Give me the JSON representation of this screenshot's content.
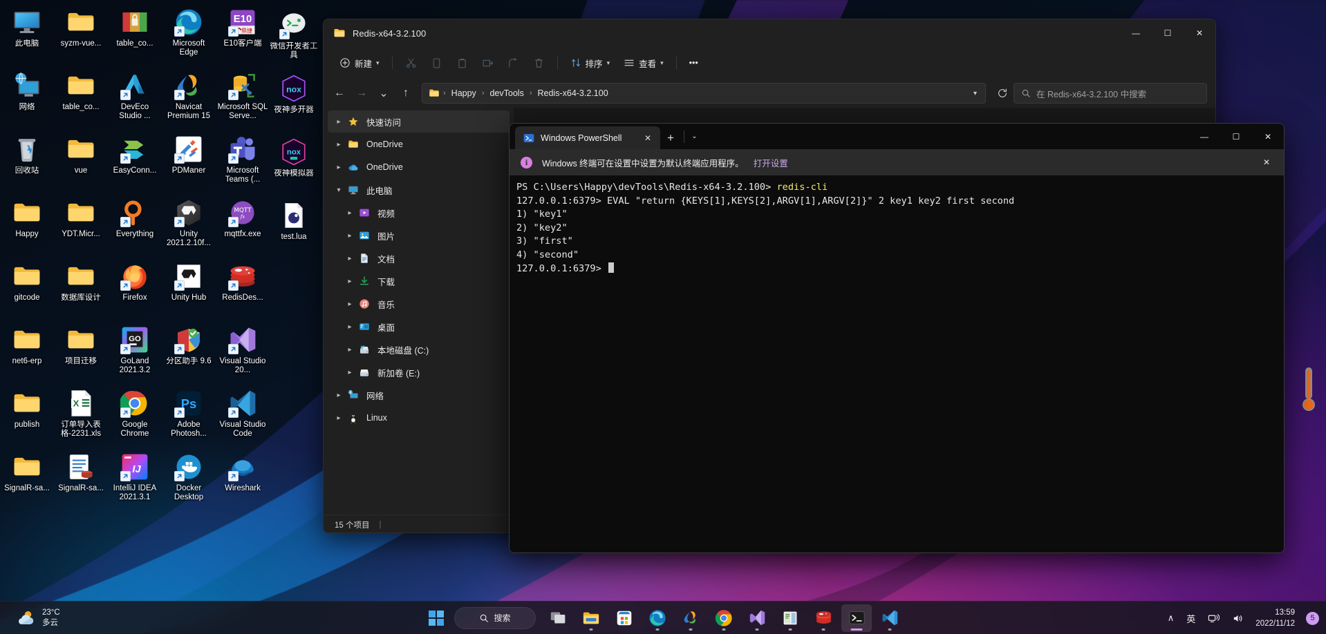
{
  "desktop": {
    "icons": [
      {
        "label": "此电脑",
        "icon": "this-pc-icon",
        "shortcut": false
      },
      {
        "label": "syzm-vue...",
        "icon": "folder-icon",
        "shortcut": false
      },
      {
        "label": "table_co...",
        "icon": "winrar-archive-icon",
        "shortcut": false
      },
      {
        "label": "Microsoft Edge",
        "icon": "microsoft-edge-icon",
        "shortcut": true
      },
      {
        "label": "E10客户端",
        "icon": "e10-client-icon",
        "shortcut": true
      },
      {
        "label": "网络",
        "icon": "network-icon",
        "shortcut": false
      },
      {
        "label": "table_co...",
        "icon": "folder-icon",
        "shortcut": false
      },
      {
        "label": "DevEco Studio ...",
        "icon": "deveco-studio-icon",
        "shortcut": true
      },
      {
        "label": "Navicat Premium 15",
        "icon": "navicat-icon",
        "shortcut": true
      },
      {
        "label": "Microsoft SQL Serve...",
        "icon": "sql-server-icon",
        "shortcut": true
      },
      {
        "label": "回收站",
        "icon": "recycle-bin-icon",
        "shortcut": false
      },
      {
        "label": "vue",
        "icon": "folder-icon",
        "shortcut": false
      },
      {
        "label": "EasyConn...",
        "icon": "easyconnect-icon",
        "shortcut": true
      },
      {
        "label": "PDManer",
        "icon": "pdmaner-icon",
        "shortcut": true
      },
      {
        "label": "Microsoft Teams (...",
        "icon": "microsoft-teams-icon",
        "shortcut": true
      },
      {
        "label": "Happy",
        "icon": "folder-icon",
        "shortcut": false
      },
      {
        "label": "YDT.Micr...",
        "icon": "folder-icon",
        "shortcut": false
      },
      {
        "label": "Everything",
        "icon": "everything-icon",
        "shortcut": true
      },
      {
        "label": "Unity 2021.2.10f...",
        "icon": "unity-icon",
        "shortcut": true
      },
      {
        "label": "mqttfx.exe",
        "icon": "mqttfx-icon",
        "shortcut": true
      },
      {
        "label": "gitcode",
        "icon": "folder-icon",
        "shortcut": false
      },
      {
        "label": "数据库设计",
        "icon": "folder-icon",
        "shortcut": false
      },
      {
        "label": "Firefox",
        "icon": "firefox-icon",
        "shortcut": true
      },
      {
        "label": "Unity Hub",
        "icon": "unity-hub-icon",
        "shortcut": true
      },
      {
        "label": "RedisDes...",
        "icon": "redis-desktop-icon",
        "shortcut": true
      },
      {
        "label": "net6-erp",
        "icon": "folder-icon",
        "shortcut": false
      },
      {
        "label": "项目迁移",
        "icon": "folder-icon",
        "shortcut": false
      },
      {
        "label": "GoLand 2021.3.2",
        "icon": "goland-icon",
        "shortcut": true
      },
      {
        "label": "分区助手 9.6",
        "icon": "partition-assistant-icon",
        "shortcut": true
      },
      {
        "label": "Visual Studio 20...",
        "icon": "visual-studio-icon",
        "shortcut": true
      },
      {
        "label": "publish",
        "icon": "folder-icon",
        "shortcut": false
      },
      {
        "label": "订单导入表格-2231.xls",
        "icon": "excel-file-icon",
        "shortcut": false
      },
      {
        "label": "Google Chrome",
        "icon": "google-chrome-icon",
        "shortcut": true
      },
      {
        "label": "Adobe Photosh...",
        "icon": "photoshop-icon",
        "shortcut": true
      },
      {
        "label": "Visual Studio Code",
        "icon": "vscode-icon",
        "shortcut": true
      },
      {
        "label": "SignalR-sa...",
        "icon": "folder-icon",
        "shortcut": false
      },
      {
        "label": "SignalR-sa...",
        "icon": "sql-script-icon",
        "shortcut": false
      },
      {
        "label": "IntelliJ IDEA 2021.3.1",
        "icon": "intellij-idea-icon",
        "shortcut": true
      },
      {
        "label": "Docker Desktop",
        "icon": "docker-icon",
        "shortcut": true
      },
      {
        "label": "Wireshark",
        "icon": "wireshark-icon",
        "shortcut": true
      }
    ],
    "col3_extra": [
      {
        "label": "微信开发者工具",
        "icon": "wechat-devtools-icon",
        "shortcut": true
      },
      {
        "label": "夜神多开器",
        "icon": "nox-multi-icon",
        "shortcut": false
      },
      {
        "label": "夜神模拟器",
        "icon": "nox-player-icon",
        "shortcut": false
      },
      {
        "label": "test.lua",
        "icon": "lua-file-icon",
        "shortcut": false
      }
    ]
  },
  "explorer": {
    "title": "Redis-x64-3.2.100",
    "window_controls": {
      "minimize": "—",
      "maximize": "☐",
      "close": "✕"
    },
    "toolbar": {
      "new_label": "新建",
      "cut_label": "剪切",
      "copy_label": "复制",
      "paste_label": "粘贴",
      "rename_label": "重命名",
      "share_label": "共享",
      "delete_label": "删除",
      "sort_label": "排序",
      "view_label": "查看",
      "more_label": "•••"
    },
    "address": {
      "back": "←",
      "forward": "→",
      "recent": "⌄",
      "up": "↑",
      "breadcrumbs": [
        "Happy",
        "devTools",
        "Redis-x64-3.2.100"
      ],
      "separator": "›",
      "refresh_title": "刷新"
    },
    "search": {
      "placeholder": "在 Redis-x64-3.2.100 中搜索"
    },
    "sidebar": [
      {
        "label": "快速访问",
        "icon": "star-icon",
        "expanded": false,
        "indent": 0,
        "selected": true
      },
      {
        "label": "OneDrive",
        "icon": "folder-icon",
        "expanded": false,
        "indent": 0,
        "selected": false
      },
      {
        "label": "OneDrive",
        "icon": "onedrive-cloud-icon",
        "expanded": false,
        "indent": 0,
        "selected": false
      },
      {
        "label": "此电脑",
        "icon": "this-pc-icon",
        "expanded": true,
        "indent": 0,
        "selected": false
      },
      {
        "label": "视频",
        "icon": "videos-icon",
        "expanded": false,
        "indent": 1,
        "selected": false
      },
      {
        "label": "图片",
        "icon": "pictures-icon",
        "expanded": false,
        "indent": 1,
        "selected": false
      },
      {
        "label": "文档",
        "icon": "documents-icon",
        "expanded": false,
        "indent": 1,
        "selected": false
      },
      {
        "label": "下载",
        "icon": "downloads-icon",
        "expanded": false,
        "indent": 1,
        "selected": false
      },
      {
        "label": "音乐",
        "icon": "music-icon",
        "expanded": false,
        "indent": 1,
        "selected": false
      },
      {
        "label": "桌面",
        "icon": "desktop-icon",
        "expanded": false,
        "indent": 1,
        "selected": false
      },
      {
        "label": "本地磁盘 (C:)",
        "icon": "local-disk-icon",
        "expanded": false,
        "indent": 1,
        "selected": false
      },
      {
        "label": "新加卷 (E:)",
        "icon": "drive-icon",
        "expanded": false,
        "indent": 1,
        "selected": false
      },
      {
        "label": "网络",
        "icon": "network-icon",
        "expanded": false,
        "indent": 0,
        "selected": false
      },
      {
        "label": "Linux",
        "icon": "linux-penguin-icon",
        "expanded": false,
        "indent": 0,
        "selected": false
      }
    ],
    "status": {
      "item_count": "15 个项目",
      "divider": "|"
    }
  },
  "terminal": {
    "tab": {
      "title": "Windows PowerShell",
      "close": "✕"
    },
    "new_tab": "+",
    "tab_dropdown": "⌄",
    "window_controls": {
      "minimize": "—",
      "maximize": "☐",
      "close": "✕"
    },
    "notice": {
      "icon": "info-icon",
      "text": "Windows 终端可在设置中设置为默认终端应用程序。",
      "link": "打开设置",
      "close": "✕"
    },
    "lines": [
      {
        "prompt": "PS C:\\Users\\Happy\\devTools\\Redis-x64-3.2.100> ",
        "cmd": "redis-cli",
        "cmd_color": "yellow"
      },
      {
        "prompt": "127.0.0.1:6379> ",
        "cmd": "EVAL \"return {KEYS[1],KEYS[2],ARGV[1],ARGV[2]}\" 2 key1 key2 first second",
        "cmd_color": "white"
      },
      {
        "prompt": "1) \"key1\"",
        "cmd": "",
        "cmd_color": "white"
      },
      {
        "prompt": "2) \"key2\"",
        "cmd": "",
        "cmd_color": "white"
      },
      {
        "prompt": "3) \"first\"",
        "cmd": "",
        "cmd_color": "white"
      },
      {
        "prompt": "4) \"second\"",
        "cmd": "",
        "cmd_color": "white"
      },
      {
        "prompt": "127.0.0.1:6379> ",
        "cmd": "",
        "cmd_color": "white",
        "cursor": true
      }
    ]
  },
  "taskbar": {
    "weather": {
      "temperature": "23°C",
      "condition": "多云",
      "icon": "partly-cloudy-icon"
    },
    "start": {
      "label": "开始",
      "icon": "windows-start-icon"
    },
    "search": {
      "label": "搜索",
      "icon": "search-icon"
    },
    "items": [
      {
        "name": "task-view",
        "icon": "task-view-icon",
        "running": false,
        "active": false
      },
      {
        "name": "file-explorer",
        "icon": "file-explorer-icon",
        "running": true,
        "active": false
      },
      {
        "name": "microsoft-store",
        "icon": "microsoft-store-icon",
        "running": false,
        "active": false
      },
      {
        "name": "microsoft-edge",
        "icon": "microsoft-edge-icon",
        "running": true,
        "active": false
      },
      {
        "name": "navicat",
        "icon": "navicat-icon",
        "running": true,
        "active": false
      },
      {
        "name": "google-chrome",
        "icon": "google-chrome-icon",
        "running": true,
        "active": false
      },
      {
        "name": "visual-studio",
        "icon": "visual-studio-icon",
        "running": true,
        "active": false
      },
      {
        "name": "sql-server-management-studio",
        "icon": "ssms-icon",
        "running": true,
        "active": false
      },
      {
        "name": "redis-desktop-manager",
        "icon": "redis-desktop-icon",
        "running": true,
        "active": false
      },
      {
        "name": "windows-terminal",
        "icon": "windows-terminal-icon",
        "running": true,
        "active": true
      },
      {
        "name": "visual-studio-code",
        "icon": "vscode-icon",
        "running": true,
        "active": false
      }
    ],
    "tray": {
      "overflow": "∧",
      "ime": "英",
      "network": "network-icon",
      "volume": "volume-icon",
      "time": "13:59",
      "date": "2022/11/12",
      "notification_count": "5"
    }
  }
}
